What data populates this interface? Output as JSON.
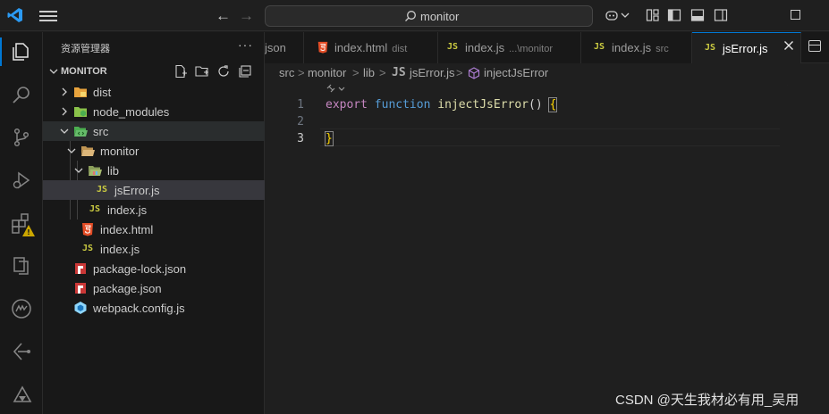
{
  "titlebar": {
    "search_text": "monitor",
    "back_icon": "arrow-left-icon",
    "forward_icon": "arrow-right-icon"
  },
  "activity_bar": {
    "items": [
      "explorer-icon",
      "search-icon",
      "source-control-icon",
      "run-debug-icon",
      "extensions-icon",
      "remote-explorer-icon",
      "aw-icon",
      "gitlens-icon",
      "extension-icon"
    ]
  },
  "sidebar": {
    "title": "资源管理器",
    "more": "···",
    "section": "MONITOR",
    "tree": [
      {
        "label": "dist"
      },
      {
        "label": "node_modules"
      },
      {
        "label": "src"
      },
      {
        "label": "monitor"
      },
      {
        "label": "lib"
      },
      {
        "label": "jsError.js",
        "badge": "JS"
      },
      {
        "label": "index.js",
        "badge": "JS"
      },
      {
        "label": "index.html"
      },
      {
        "label": "index.js",
        "badge": "JS"
      },
      {
        "label": "package-lock.json"
      },
      {
        "label": "package.json"
      },
      {
        "label": "webpack.config.js"
      }
    ]
  },
  "tabs": [
    {
      "label": "json"
    },
    {
      "label": "index.html",
      "desc": "dist"
    },
    {
      "label": "index.js",
      "desc": "...\\monitor",
      "badge": "JS"
    },
    {
      "label": "index.js",
      "desc": "src",
      "badge": "JS"
    },
    {
      "label": "jsError.js",
      "badge": "JS",
      "active": true
    }
  ],
  "breadcrumb": {
    "parts": [
      "src",
      "monitor",
      "lib",
      "jsError.js",
      "injectJsError"
    ],
    "sep": ">",
    "badge": "JS"
  },
  "editor": {
    "line_numbers": [
      "1",
      "2",
      "3"
    ],
    "code": {
      "kw_export": "export",
      "kw_function": "function",
      "fn_name": "injectJsError",
      "parens": "()",
      "open_brace": "{",
      "close_brace": "}"
    }
  },
  "watermark": "CSDN @天生我材必有用_吴用",
  "colors": {
    "accent": "#0078d4",
    "js_badge": "#cbcb41",
    "html_icon": "#e44d26",
    "npm_icon": "#cb3837",
    "keyword": "#c586c0",
    "function": "#dcdcaa"
  }
}
